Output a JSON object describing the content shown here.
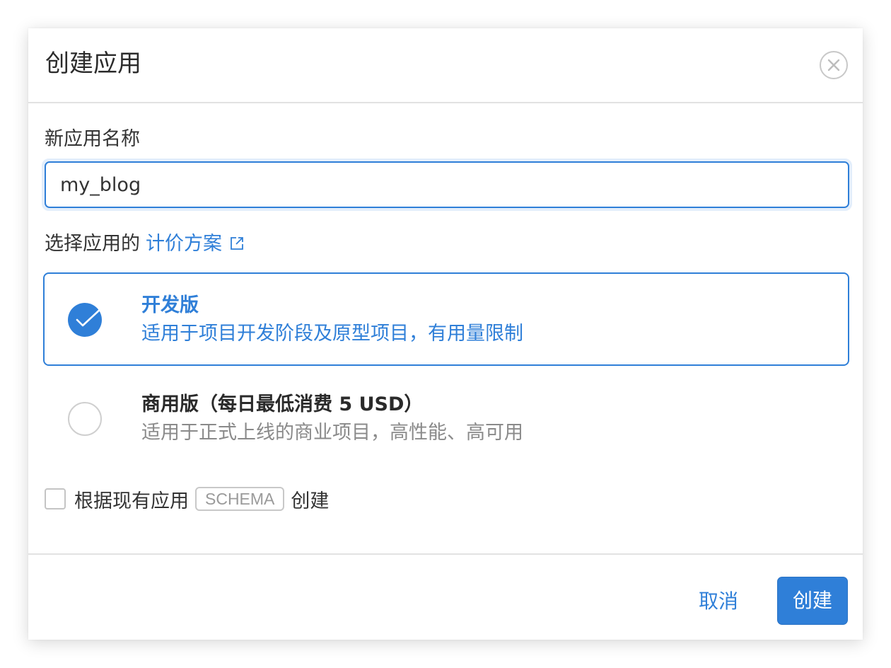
{
  "dialog": {
    "title": "创建应用"
  },
  "name_field": {
    "label": "新应用名称",
    "value": "my_blog"
  },
  "plan_section": {
    "label_prefix": "选择应用的",
    "link_text": "计价方案"
  },
  "plans": [
    {
      "name": "开发版",
      "description": "适用于项目开发阶段及原型项目，有用量限制",
      "selected": true
    },
    {
      "name": "商用版（每日最低消费 5 USD）",
      "description": "适用于正式上线的商业项目，高性能、高可用",
      "selected": false
    }
  ],
  "schema_option": {
    "prefix": "根据现有应用",
    "badge": "SCHEMA",
    "suffix": "创建",
    "checked": false
  },
  "footer": {
    "cancel_label": "取消",
    "create_label": "创建"
  },
  "colors": {
    "accent": "#2f7fd8",
    "divider": "#e2e2e2",
    "muted_text": "#8a8a8a"
  },
  "icons": {
    "close": "close-icon",
    "external_link": "external-link-icon",
    "checkmark": "check-icon"
  }
}
